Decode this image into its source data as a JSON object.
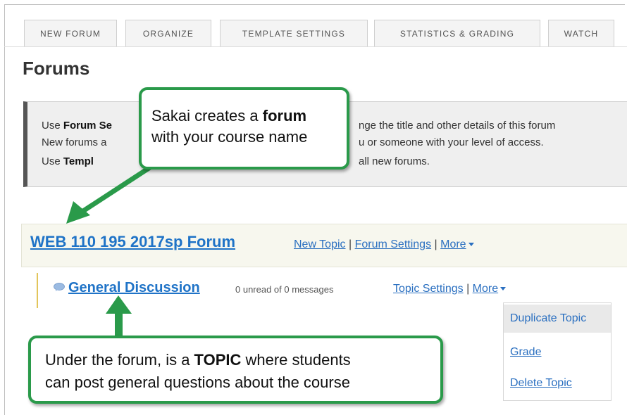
{
  "tabs": [
    "NEW FORUM",
    "ORGANIZE",
    "TEMPLATE SETTINGS",
    "STATISTICS & GRADING",
    "WATCH"
  ],
  "page_title": "Forums",
  "instructions": {
    "line1_a": "Use ",
    "line1_b": "Forum Se",
    "line1_c": "nge the title and other details of this forum",
    "line2_a": "New forums a",
    "line2_b": "u or someone with your level of access.",
    "line3_a": "Use ",
    "line3_b": "Templ",
    "line3_c": "all new forums."
  },
  "forum": {
    "title": "WEB 110 195 2017sp Forum",
    "new_topic": "New Topic",
    "settings": "Forum Settings",
    "more": "More",
    "sep": "|"
  },
  "topic": {
    "title": "General Discussion",
    "meta": "0 unread of 0 messages",
    "settings": "Topic Settings",
    "more": "More",
    "sep": "|"
  },
  "more_menu": [
    "Duplicate Topic",
    "Grade",
    "Delete Topic"
  ],
  "callout_forum": {
    "l1a": "Sakai creates a ",
    "l1b": "forum",
    "l2": "with your course name"
  },
  "callout_topic": {
    "l1a": "Under the forum, is a ",
    "l1b": "TOPIC",
    "l1c": " where students",
    "l2": "can post general questions about the course"
  },
  "colors": {
    "callout_border": "#2a9a4a",
    "link": "#2a6fc0",
    "forum_title": "#1f73c7"
  }
}
